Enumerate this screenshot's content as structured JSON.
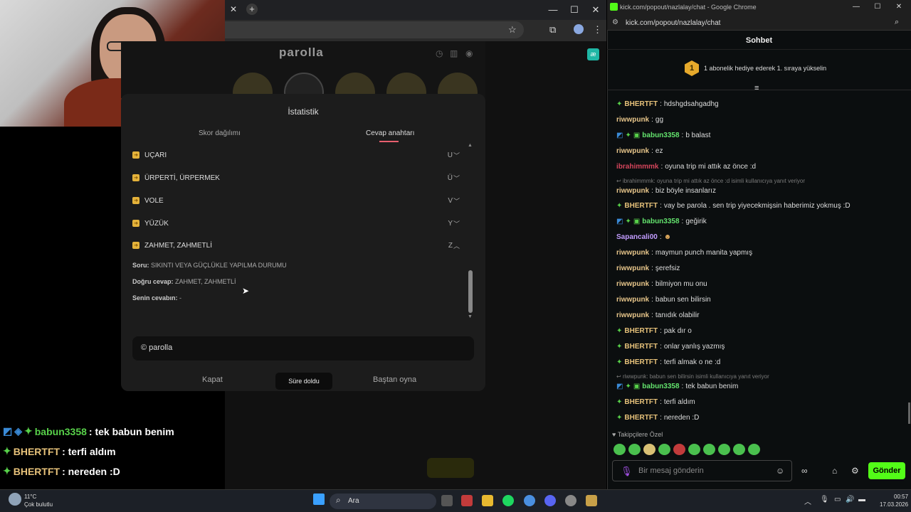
{
  "parolla": {
    "logo": "parolla",
    "modal_title": "İstatistik",
    "tabs": [
      "Skor dağılımı",
      "Cevap anahtarı"
    ],
    "rows": [
      {
        "word": "UÇARI",
        "letter": "U"
      },
      {
        "word": "ÜRPERTİ, ÜRPERMEK",
        "letter": "Ü"
      },
      {
        "word": "VOLE",
        "letter": "V"
      },
      {
        "word": "YÜZÜK",
        "letter": "Y"
      },
      {
        "word": "ZAHMET, ZAHMETLİ",
        "letter": "Z"
      }
    ],
    "detail": {
      "question_label": "Soru:",
      "question": "SIKINTI VEYA GÜÇLÜKLE YAPILMA DURUMU",
      "answer_label": "Doğru cevap:",
      "answer": "ZAHMET, ZAHMETLİ",
      "yours_label": "Senin cevabın:",
      "yours": "-"
    },
    "credit": "© parolla",
    "buttons": {
      "close": "Kapat",
      "timeout": "Süre doldu",
      "restart": "Baştan oyna"
    }
  },
  "overlay_chat": [
    {
      "user": "babun3358",
      "text": ": tek babun benim"
    },
    {
      "user": "BHERTFT",
      "text": ": terfi aldım"
    },
    {
      "user": "BHERTFT",
      "text": ": nereden :D"
    }
  ],
  "kick": {
    "window_title": "kick.com/popout/nazlalay/chat - Google Chrome",
    "url": "kick.com/popout/nazlalay/chat",
    "header": "Sohbet",
    "banner_rank": "1",
    "banner": "1 abonelik hediye ederek 1. sıraya yükselin",
    "messages": [
      {
        "user": "BHERTFT",
        "text": "hdshgdsahgadhg"
      },
      {
        "user": "riwwpunk",
        "text": "gg"
      },
      {
        "user": "babun3358",
        "text": "b balast"
      },
      {
        "user": "riwwpunk",
        "text": "ez"
      },
      {
        "user": "ibrahimmmk",
        "text": "oyuna trip mi attık az önce :d"
      },
      {
        "user": "riwwpunk",
        "text": "biz böyle insanlarız"
      },
      {
        "user": "BHERTFT",
        "text": "vay be parola . sen trip yiyecekmişsin haberimiz yokmuş :D"
      },
      {
        "user": "babun3358",
        "text": "geğirik"
      },
      {
        "user": "Sapancali00",
        "text": ""
      },
      {
        "user": "riwwpunk",
        "text": "maymun punch manita yapmış"
      },
      {
        "user": "riwwpunk",
        "text": "şerefsiz"
      },
      {
        "user": "riwwpunk",
        "text": "bilmiyon mu onu"
      },
      {
        "user": "riwwpunk",
        "text": "babun sen bilirsin"
      },
      {
        "user": "riwwpunk",
        "text": "tanıdık olabilir"
      },
      {
        "user": "BHERTFT",
        "text": "pak dır o"
      },
      {
        "user": "BHERTFT",
        "text": "onlar yanlış yazmış"
      },
      {
        "user": "BHERTFT",
        "text": "terfi almak o ne :d"
      },
      {
        "user": "babun3358",
        "text": "tek babun benim"
      },
      {
        "user": "BHERTFT",
        "text": "terfi aldım"
      },
      {
        "user": "BHERTFT",
        "text": "nereden :D"
      }
    ],
    "reply_1": "ibrahimmmk: oyuna trip mi attık az önce :d isimli kullanıcıya yanıt veriyor",
    "reply_2": "riwwpunk: babun sen bilirsin isimli kullanıcıya yanıt veriyor",
    "followers_only": "Takipçilere Özel",
    "input_placeholder": "Bir mesaj gönderin",
    "send": "Gönder"
  },
  "taskbar": {
    "temp": "11°C",
    "weather": "Çok bulutlu",
    "search": "Ara",
    "time": "00:57",
    "date": "17.03.2026"
  }
}
